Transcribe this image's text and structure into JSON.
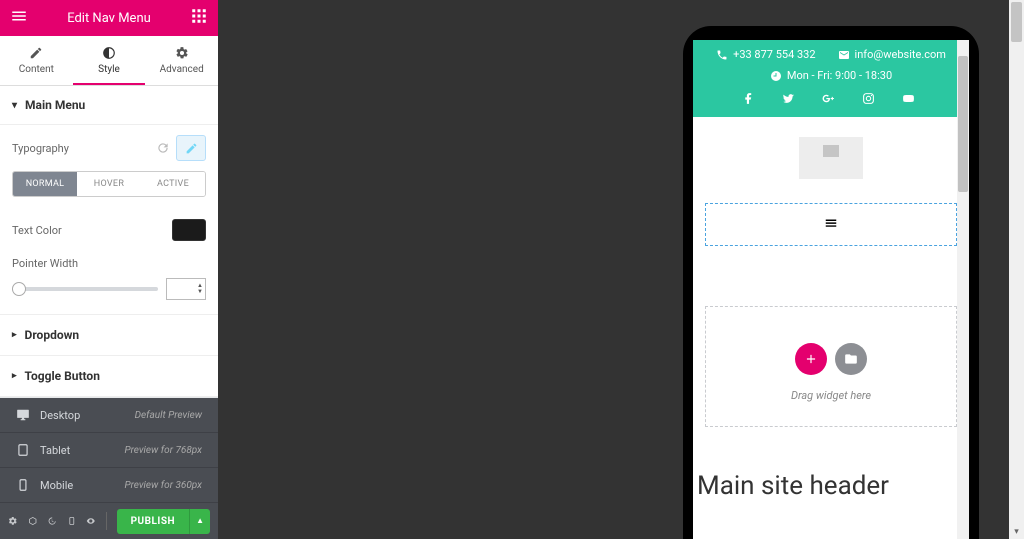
{
  "header": {
    "title": "Edit Nav Menu"
  },
  "tabs": {
    "content": "Content",
    "style": "Style",
    "advanced": "Advanced"
  },
  "section_main": {
    "title": "Main Menu"
  },
  "typography": {
    "label": "Typography"
  },
  "states": {
    "normal": "NORMAL",
    "hover": "HOVER",
    "active": "ACTIVE"
  },
  "textcolor": {
    "label": "Text Color"
  },
  "pointerwidth": {
    "label": "Pointer Width",
    "value": ""
  },
  "section_dropdown": {
    "title": "Dropdown"
  },
  "section_toggle": {
    "title": "Toggle Button"
  },
  "devices": {
    "desktop": {
      "label": "Desktop",
      "hint": "Default Preview"
    },
    "tablet": {
      "label": "Tablet",
      "hint": "Preview for 768px"
    },
    "mobile": {
      "label": "Mobile",
      "hint": "Preview for 360px"
    }
  },
  "footer": {
    "publish": "PUBLISH"
  },
  "preview": {
    "phone": "+33 877 554 332",
    "email": "info@website.com",
    "hours": "Mon - Fri: 9:00 - 18:30",
    "drag": "Drag widget here",
    "page_header": "Main site header"
  }
}
